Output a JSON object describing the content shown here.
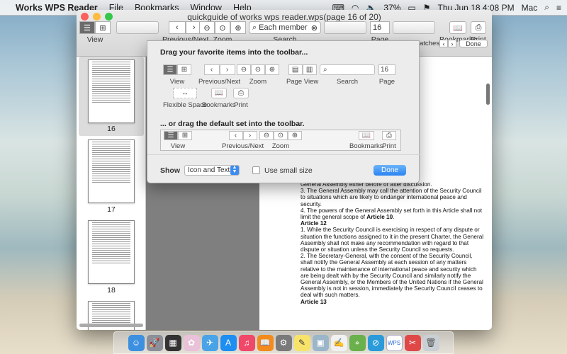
{
  "menubar": {
    "app_name": "Works WPS Reader",
    "items": [
      "File",
      "Bookmarks",
      "Window",
      "Help"
    ],
    "battery": "37%",
    "clock": "Thu Jun 18  4:08 PM",
    "user": "Mac"
  },
  "window": {
    "title": "quickguide of works wps reader.wps(page 16 of 20)",
    "toolbar": {
      "view_label": "View",
      "prevnext_label": "Previous/Next",
      "zoom_label": "Zoom",
      "search_label": "Search",
      "search_placeholder": "Each member",
      "page_label": "Page",
      "page_value": "16",
      "bookmarks_label": "Bookmarks",
      "print_label": "Print"
    },
    "findbar": {
      "matches_label": "atches",
      "done_label": "Done"
    }
  },
  "sidebar": {
    "thumbnails": [
      {
        "page": "16",
        "selected": true
      },
      {
        "page": "17",
        "selected": false
      },
      {
        "page": "18",
        "selected": false
      }
    ]
  },
  "popover": {
    "heading_custom": "Drag your favorite items into the toolbar...",
    "heading_default": "... or drag the default set into the toolbar.",
    "items": {
      "view": "View",
      "prevnext": "Previous/Next",
      "zoom": "Zoom",
      "pageview": "Page View",
      "search": "Search",
      "page": "Page",
      "page_value": "16",
      "flexible_space": "Flexible Space",
      "bookmarks": "Bookmarks",
      "print": "Print"
    },
    "default_set": {
      "view": "View",
      "prevnext": "Previous/Next",
      "zoom": "Zoom",
      "bookmarks": "Bookmarks",
      "print": "Print"
    },
    "show_label": "Show",
    "show_value": "Icon and Text",
    "small_size_label": "Use small size",
    "done_label": "Done"
  },
  "document": {
    "lines": [
      {
        "text": "General Assembly either before or after discussion.",
        "bold": false
      },
      {
        "text": "3. The General Assembly may call the attention of the Security Council to situations which are likely to endanger international peace and security.",
        "bold": false
      },
      {
        "text": "4. The powers of the General Assembly set forth in this Article shall not limit the general scope of ",
        "bold": false,
        "bold_suffix": "Article 10",
        "suffix": "."
      },
      {
        "text": "Article 12",
        "bold": true
      },
      {
        "text": "1. While the Security Council is exercising in respect of any dispute or situation the functions assigned to it in the present Charter, the General Assembly shall not make any recommendation with regard to that dispute or situation unless the Security Council so requests.",
        "bold": false
      },
      {
        "text": "2. The Secretary-General, with the consent of the Security Council, shall notify the General Assembly at each session of any matters relative to the maintenance of international peace and security which are being dealt with by the Security Council and similarly notify the General Assembly, or the Members of the United Nations if the General Assembly is not in session, immediately the Security Council ceases to deal with such matters.",
        "bold": false
      },
      {
        "text": "Article 13",
        "bold": true
      }
    ]
  },
  "dock": {
    "icons": [
      "finder-icon",
      "launchpad-icon",
      "photo-booth-icon",
      "photos-icon",
      "safari-icon",
      "app-store-icon",
      "music-icon",
      "ibooks-icon",
      "system-prefs-icon",
      "notes-icon",
      "preview-icon",
      "textedit-icon",
      "maps-icon",
      "safari2-icon",
      "wps-icon",
      "app-icon",
      "trash-icon"
    ]
  }
}
